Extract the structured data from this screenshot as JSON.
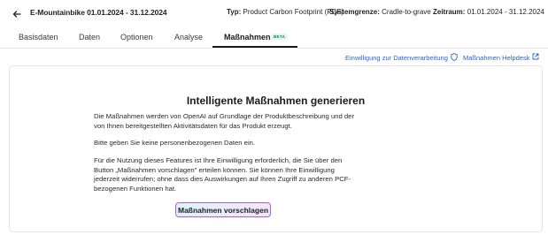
{
  "header": {
    "title": "E-Mountainbike 01.01.2024 - 31.12.2024",
    "typ_label": "Typ:",
    "typ_value": "Product Carbon Footprint (PCF)",
    "system_label": "Systemgrenze:",
    "system_value": "Cradle-to-grave",
    "zeitraum_label": "Zeitraum:",
    "zeitraum_value": "01.01.2024 - 31.12.2024"
  },
  "tabs": [
    {
      "label": "Basisdaten"
    },
    {
      "label": "Daten"
    },
    {
      "label": "Optionen"
    },
    {
      "label": "Analyse"
    },
    {
      "label": "Maßnahmen",
      "badge": "BETA",
      "active": true
    }
  ],
  "links": {
    "consent": "Einwilligung zur Datenverarbeitung",
    "helpdesk": "Maßnahmen Helpdesk"
  },
  "panel": {
    "heading": "Intelligente Maßnahmen generieren",
    "para1": "Die Maßnahmen werden von OpenAI auf Grundlage der Produktbeschreibung und der von Ihnen bereitgestellten Aktivitätsdaten für das Produkt erzeugt.",
    "para2": "Bitte geben Sie keine personenbezogenen Daten ein.",
    "para3": "Für die Nutzung dieses Features ist Ihre Einwilligung erforderlich, die Sie über den Button „Maßnahmen vorschlagen\" erteilen können. Sie können Ihre Einwilligung jederzeit widerrufen; ohne dass dies Auswirkungen auf Ihren Zugriff zu anderen PCF-bezogenen Funktionen hat.",
    "button": "Maßnahmen vorschlagen"
  },
  "colors": {
    "link": "#2b63d4",
    "beta_text": "#177b6d",
    "beta_bg": "#dff5f0",
    "button_border": "#b25cd9"
  }
}
